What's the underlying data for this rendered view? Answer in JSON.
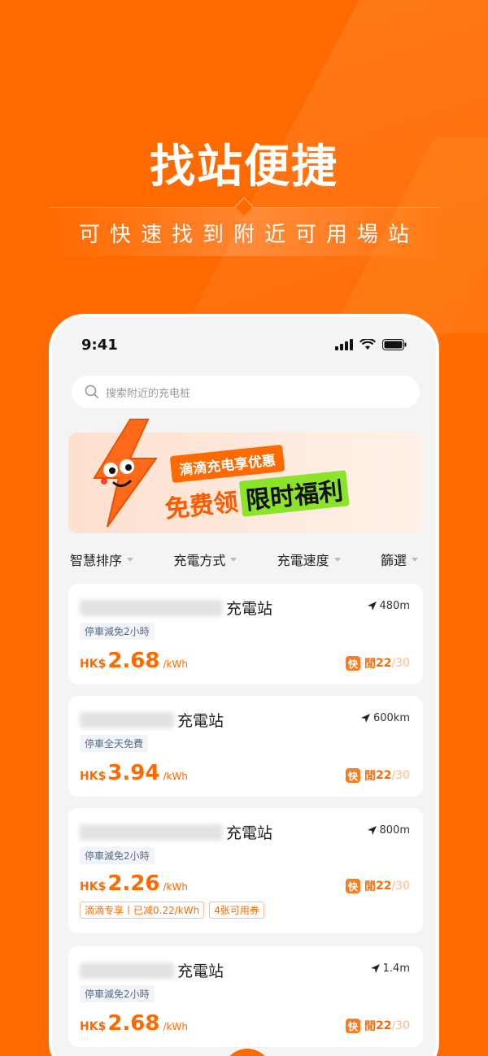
{
  "hero": {
    "title": "找站便捷",
    "subtitle": "可快速找到附近可用場站"
  },
  "status_bar": {
    "time": "9:41"
  },
  "search": {
    "placeholder": "搜索附近的充电桩",
    "icon": "search-icon"
  },
  "banner": {
    "tag": "滴滴充电享优惠",
    "free_text": "免费领",
    "highlight_text": "限时福利"
  },
  "filters": [
    {
      "label": "智慧排序"
    },
    {
      "label": "充電方式"
    },
    {
      "label": "充電速度"
    },
    {
      "label": "篩選"
    }
  ],
  "stations": [
    {
      "name_suffix": "充電站",
      "distance": "480m",
      "tag": "停車減免2小時",
      "currency": "HK$",
      "price": "2.68",
      "unit": "/kWh",
      "fast_label": "快",
      "open_label": "閒",
      "available": "22",
      "total": "/30"
    },
    {
      "name_suffix": "充電站",
      "distance": "600km",
      "tag": "停車全天免費",
      "currency": "HK$",
      "price": "3.94",
      "unit": "/kWh",
      "fast_label": "快",
      "open_label": "閒",
      "available": "22",
      "total": "/30"
    },
    {
      "name_suffix": "充電站",
      "distance": "800m",
      "tag": "停車減免2小時",
      "currency": "HK$",
      "price": "2.26",
      "unit": "/kWh",
      "fast_label": "快",
      "open_label": "閒",
      "available": "22",
      "total": "/30",
      "promos": [
        "滴滴专享丨已减0.22/kWh",
        "4张可用券"
      ]
    },
    {
      "name_suffix": "充電站",
      "distance": "1.4m",
      "tag": "停車減免2小時",
      "currency": "HK$",
      "price": "2.68",
      "unit": "/kWh",
      "fast_label": "快",
      "open_label": "閒",
      "available": "22",
      "total": "/30"
    }
  ],
  "colors": {
    "brand": "#ff6a00",
    "accent_green": "#8be32a"
  }
}
